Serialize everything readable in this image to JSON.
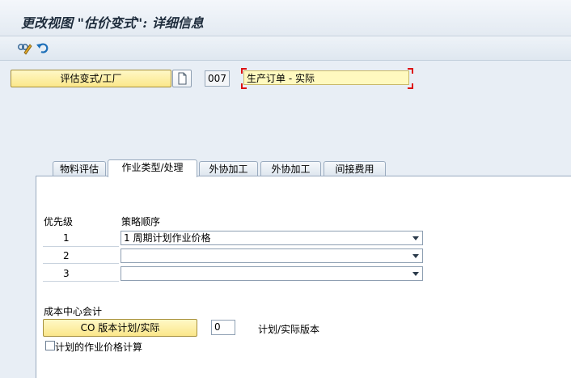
{
  "window": {
    "title": "更改视图 \"估价变式\": 详细信息"
  },
  "toolbar": {
    "icons": [
      "display-change-icon",
      "undo-icon"
    ]
  },
  "header": {
    "variant_button_label": "评估变式/工厂",
    "code_value": "007",
    "name_value": "生产订单 - 实际"
  },
  "tabs": [
    {
      "label": "物料评估"
    },
    {
      "label": "作业类型/处理",
      "active": true
    },
    {
      "label": "外协加工"
    },
    {
      "label": "外协加工"
    },
    {
      "label": "间接费用"
    }
  ],
  "strategy": {
    "priority_header": "优先级",
    "sequence_header": "策略顺序",
    "rows": [
      {
        "priority": "1",
        "value": "1 周期计划作业价格"
      },
      {
        "priority": "2",
        "value": ""
      },
      {
        "priority": "3",
        "value": ""
      }
    ]
  },
  "cost_center": {
    "section_label": "成本中心会计",
    "version_button_label": "CO 版本计划/实际",
    "version_value": "0",
    "version_text": "计划/实际版本",
    "checkbox_label": "计划的作业价格计算",
    "checkbox_checked": false
  }
}
